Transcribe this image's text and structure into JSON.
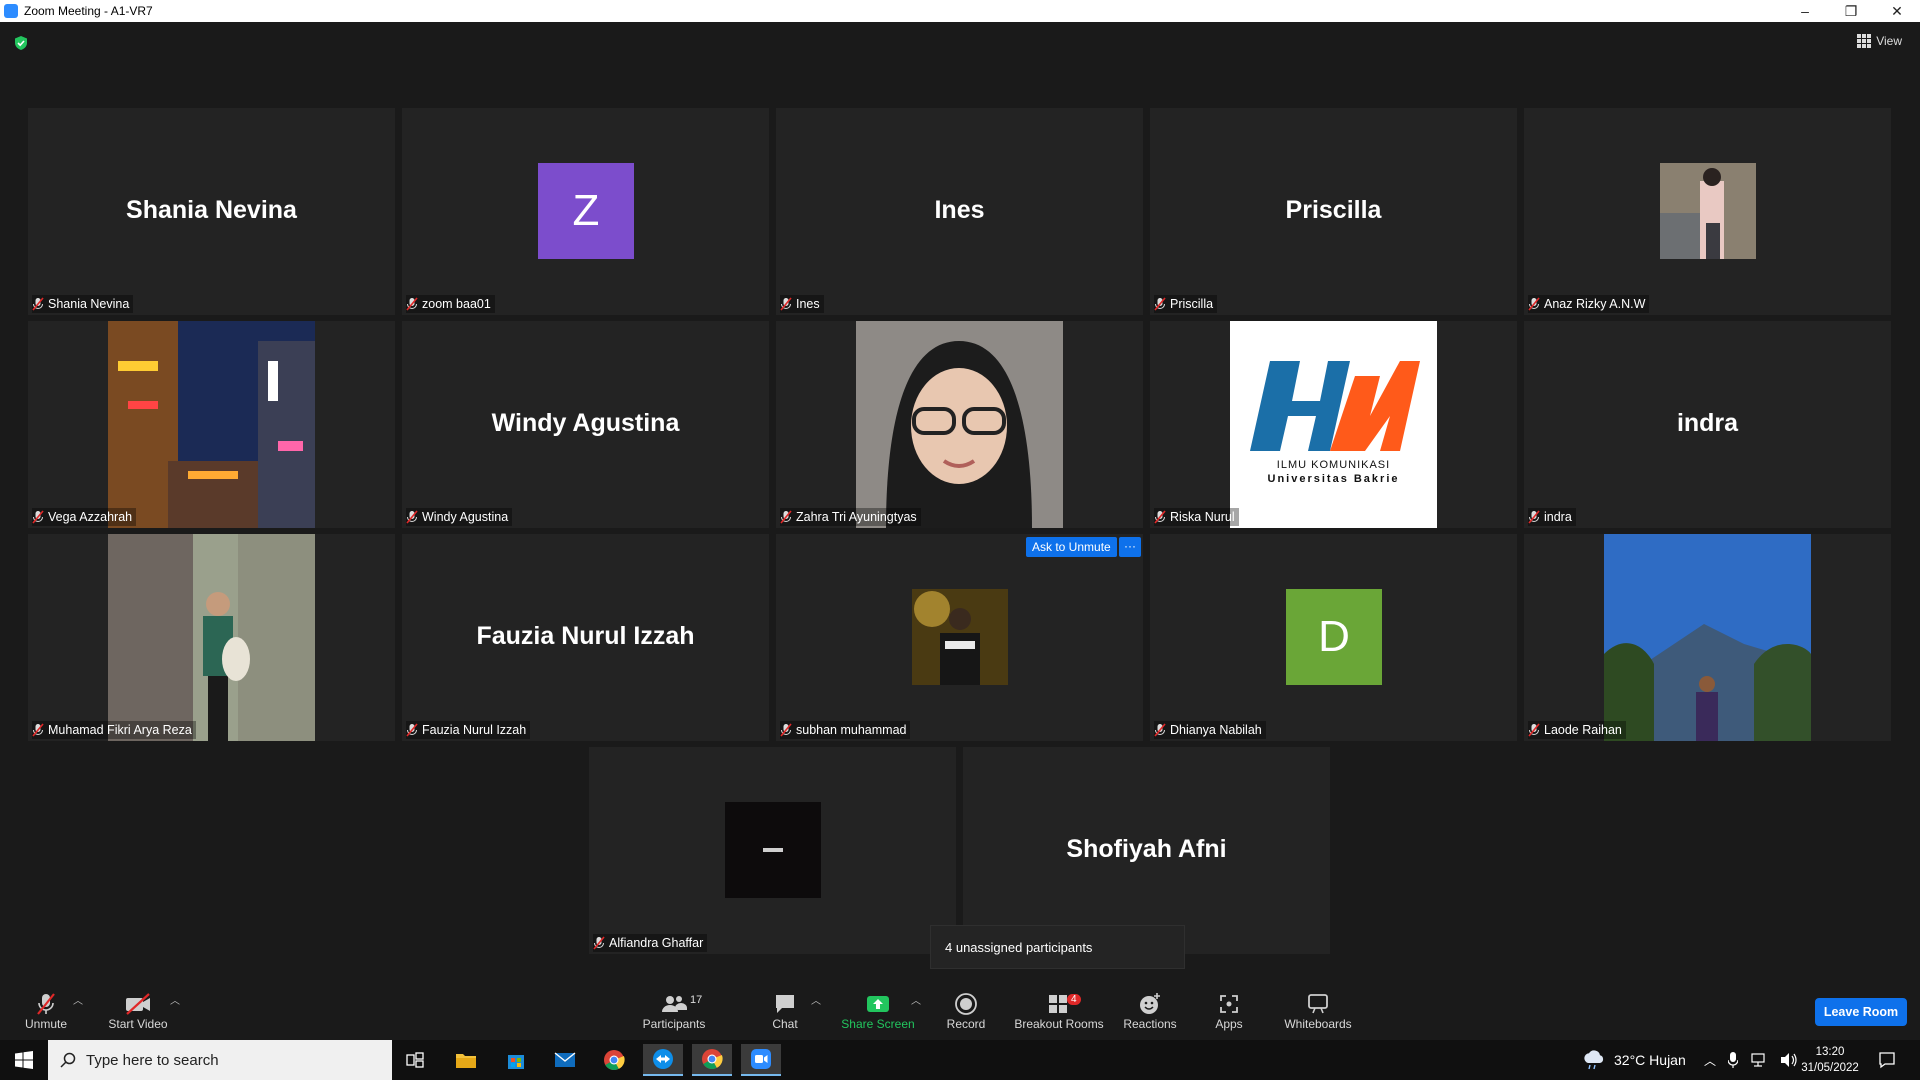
{
  "window": {
    "title": "Zoom Meeting - A1-VR7",
    "minimize": "–",
    "restore": "❐",
    "close": "✕"
  },
  "view_label": "View",
  "tiles": [
    {
      "big_name": "Shania Nevina",
      "label": "Shania Nevina"
    },
    {
      "avatar_letter": "Z",
      "avatar_color": "#7c4dcc",
      "label": "zoom baa01"
    },
    {
      "big_name": "Ines",
      "label": "Ines"
    },
    {
      "big_name": "Priscilla",
      "label": "Priscilla"
    },
    {
      "label": "Anaz Rizky A.N.W"
    },
    {
      "label": "Vega Azzahrah"
    },
    {
      "big_name": "Windy Agustina",
      "label": "Windy Agustina"
    },
    {
      "label": "Zahra Tri Ayuningtyas"
    },
    {
      "label": "Riska Nurul",
      "logo_text": [
        "ILMU KOMUNIKASI",
        "Universitas Bakrie"
      ]
    },
    {
      "big_name": "indra",
      "label": "indra"
    },
    {
      "label": "Muhamad Fikri Arya Reza"
    },
    {
      "big_name": "Fauzia Nurul Izzah",
      "label": "Fauzia Nurul Izzah"
    },
    {
      "label": "subhan muhammad"
    },
    {
      "avatar_letter": "D",
      "avatar_color": "#6aa637",
      "label": "Dhianya Nabilah"
    },
    {
      "label": "Laode Raihan"
    },
    {
      "label": "Alfiandra Ghaffar"
    },
    {
      "big_name": "Shofiyah Afni",
      "label": "Shofiyah Afni"
    }
  ],
  "ask_to_unmute": "Ask to Unmute",
  "more_dots": "···",
  "tooltip": "4 unassigned participants",
  "toolbar": {
    "unmute": "Unmute",
    "start_video": "Start Video",
    "participants": "Participants",
    "participants_count": "17",
    "chat": "Chat",
    "share_screen": "Share Screen",
    "record": "Record",
    "breakout_rooms": "Breakout Rooms",
    "breakout_count": "4",
    "reactions": "Reactions",
    "apps": "Apps",
    "whiteboards": "Whiteboards",
    "leave_room": "Leave Room"
  },
  "taskbar": {
    "search_placeholder": "Type here to search",
    "weather": "32°C  Hujan",
    "time": "13:20",
    "date": "31/05/2022"
  },
  "colors": {
    "accent": "#0e71eb",
    "share_green": "#22c55e",
    "muted_red": "#e02828"
  }
}
